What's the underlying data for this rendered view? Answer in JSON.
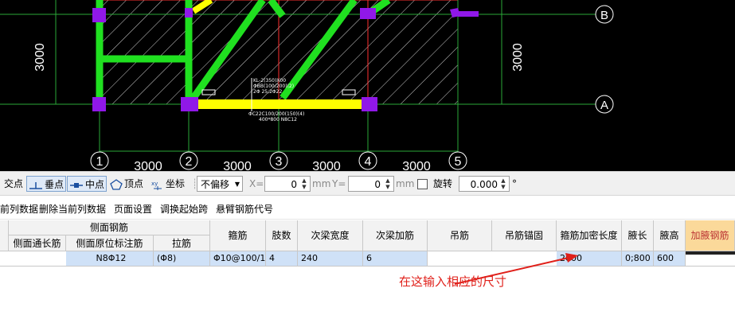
{
  "cad": {
    "grid_axes_bottom": [
      "1",
      "2",
      "3",
      "4",
      "5"
    ],
    "grid_axes_right": [
      "B",
      "A"
    ],
    "bottom_dims": [
      "3000",
      "3000",
      "3000",
      "3000"
    ],
    "left_dim": "3000",
    "right_dim": "3000",
    "beam_labels": [
      "KL-2(350)X00",
      "ΦBB(100/200)(2)",
      "2Φ 25;2Φ22",
      "ΦC22C100/200(150)(4)",
      "400*800 N8C12"
    ]
  },
  "snapbar": {
    "intersection_label": "交点",
    "perpendicular_label": "垂点",
    "midpoint_label": "中点",
    "vertex_label": "顶点",
    "coordinate_label": "坐标",
    "offset_select": "不偏移",
    "x_label": "X=",
    "x_value": "0",
    "mm1": "mm",
    "y_label": "Y=",
    "y_value": "0",
    "mm2": "mm",
    "rotate_label": "旋转",
    "rotate_value": "0.000",
    "degree": "°"
  },
  "menubar": {
    "items": [
      "前列数据",
      "删除当前列数据",
      "页面设置",
      "调换起始跨",
      "悬臂钢筋代号"
    ]
  },
  "table": {
    "group_header": "侧面钢筋",
    "headers": {
      "side_through": "侧面通长筋",
      "side_original": "侧面原位标注筋",
      "tie": "拉筋",
      "stirrup": "箍筋",
      "legs": "肢数",
      "sec_width": "次梁宽度",
      "sec_add": "次梁加筋",
      "hanger": "吊筋",
      "hanger_anchor": "吊筋锚固",
      "stirrup_dense": "箍筋加密长度",
      "haunch_len": "腋长",
      "haunch_h": "腋高",
      "haunch_bar": "加腋钢筋"
    },
    "row": {
      "side_through": "",
      "side_original": "N8Φ12",
      "tie": "(Φ8)",
      "stirrup": "Φ10@100/1",
      "legs": "4",
      "sec_width": "240",
      "sec_add": "6",
      "hanger": "",
      "hanger_anchor": "",
      "stirrup_dense": "2000",
      "haunch_len": "0;800",
      "haunch_h": "600",
      "haunch_bar": ""
    }
  },
  "annotation": "在这输入相应的尺寸",
  "colors": {
    "beam_green": "#20e020",
    "beam_yellow": "#ffff00",
    "column": "#9018e8",
    "red_line": "#ff2020",
    "grid_line": "#2aa838"
  }
}
